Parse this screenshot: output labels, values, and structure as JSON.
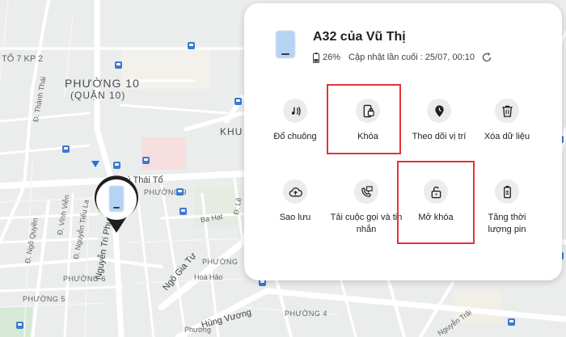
{
  "map": {
    "labels": {
      "to7kp2": "TỔ 7 KP 2",
      "phuong10": "PHƯỜNG 10",
      "quan10": "(QUẬN 10)",
      "khu": "KHU",
      "thanhthai": "Đ. Thành Thái",
      "lythaito": "Lý Thái Tổ",
      "phuong9": "PHƯỜNG 9",
      "bahat": "Ba Hạt",
      "nguyentriphuong": "Nguyễn Tri Phương",
      "vinhvien": "Đ. Vĩnh Viễn",
      "ngoquyen": "Đ. Ngô Quyền",
      "tieula": "Đ. Nguyễn Tiểu La",
      "ngogiatu": "Ngô Gia Tự",
      "phuong6": "PHƯỜNG 6",
      "phuong5": "PHƯỜNG 5",
      "hoahao": "Hoà Hảo",
      "le": "Đ. Lê",
      "phuong4": "PHƯỜNG 4",
      "phuong_mid": "PHƯỜNG",
      "phuong_bottom": "Phường",
      "hungvuong": "Hùng Vương",
      "nguyentrai": "Nguyễn Trãi"
    }
  },
  "panel": {
    "device_name": "A32 của Vũ Thị",
    "battery": "26%",
    "last_update": "Cập nhật lần cuối : 25/07, 00:10",
    "icons": {
      "device": "phone-icon",
      "battery": "battery-icon",
      "refresh": "refresh-icon"
    },
    "actions": [
      {
        "id": "ring",
        "label": "Đổ chuông",
        "icon": "ring-icon"
      },
      {
        "id": "lock",
        "label": "Khóa",
        "icon": "lock-icon"
      },
      {
        "id": "track",
        "label": "Theo dõi vị trí",
        "icon": "location-icon"
      },
      {
        "id": "erase",
        "label": "Xóa dữ liệu",
        "icon": "trash-icon"
      },
      {
        "id": "backup",
        "label": "Sao lưu",
        "icon": "cloud-upload-icon"
      },
      {
        "id": "calls",
        "label": "Tải cuộc gọi và tin nhắn",
        "icon": "call-message-icon"
      },
      {
        "id": "unlock",
        "label": "Mở khóa",
        "icon": "unlock-icon"
      },
      {
        "id": "battery_boost",
        "label": "Tăng thời lượng pin",
        "icon": "battery-saver-icon"
      }
    ]
  },
  "colors": {
    "highlight": "#e0343a",
    "accent": "#1a73e8",
    "map_bg": "#eceded",
    "road": "#ffffff"
  }
}
